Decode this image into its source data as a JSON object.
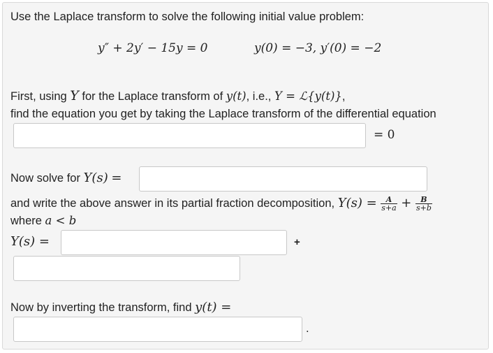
{
  "intro": "Use the Laplace transform to solve the following initial value problem:",
  "ode": "y″ + 2y′ − 15y = 0",
  "initial_conditions": "y(0) = −3,  y′(0) = −2",
  "step1": {
    "line1_a": "First, using",
    "line1_Y": "Y",
    "line1_b": "for the Laplace transform of",
    "line1_yt": "y(t)",
    "line1_c": ", i.e.,",
    "line1_def": "Y = ℒ{y(t)}",
    "line1_end": ",",
    "line2": "find the equation you get by taking the Laplace transform of the differential equation",
    "equals_zero": "= 0",
    "input_value": ""
  },
  "step2": {
    "prompt": "Now solve for",
    "Ys": "Y(s)",
    "equals": "=",
    "input_value": ""
  },
  "step3": {
    "line1": "and write the above answer in its partial fraction decomposition,",
    "Ys": "Y(s) =",
    "frac_A_num": "A",
    "frac_A_den": "s+a",
    "plus": "+",
    "frac_B_num": "B",
    "frac_B_den": "s+b",
    "where": "where",
    "condition": "a < b",
    "Ys_label": "Y(s) =",
    "plus_sign": "+",
    "input1_value": "",
    "input2_value": ""
  },
  "step4": {
    "prompt": "Now by inverting the transform, find",
    "yt": "y(t) =",
    "period": ".",
    "input_value": ""
  }
}
